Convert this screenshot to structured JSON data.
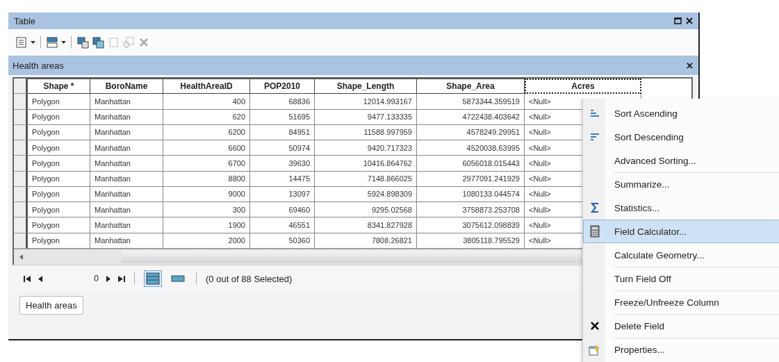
{
  "window": {
    "title": "Table"
  },
  "toolbar": [
    {
      "disabled": false
    },
    {
      "disabled": false
    },
    {
      "disabled": false
    },
    {
      "disabled": false
    },
    {
      "disabled": true
    },
    {
      "disabled": true
    },
    {
      "disabled": true
    }
  ],
  "table_name": "Health areas",
  "table": {
    "columns": [
      {
        "label": "Shape *",
        "selected": false
      },
      {
        "label": "BoroName",
        "selected": false
      },
      {
        "label": "HealthAreaID",
        "selected": false
      },
      {
        "label": "POP2010",
        "selected": false
      },
      {
        "label": "Shape_Length",
        "selected": false
      },
      {
        "label": "Shape_Area",
        "selected": false
      },
      {
        "label": "Acres",
        "selected": true
      }
    ],
    "rows": [
      [
        "Polygon",
        "Manhattan",
        "400",
        "68836",
        "12014.993167",
        "5873344.359519",
        "<Null>"
      ],
      [
        "Polygon",
        "Manhattan",
        "620",
        "51695",
        "9477.133335",
        "4722438.403642",
        "<Null>"
      ],
      [
        "Polygon",
        "Manhattan",
        "6200",
        "84951",
        "11588.997959",
        "4578249.29951",
        "<Null>"
      ],
      [
        "Polygon",
        "Manhattan",
        "6600",
        "50974",
        "9420.717323",
        "4520038.63995",
        "<Null>"
      ],
      [
        "Polygon",
        "Manhattan",
        "6700",
        "39630",
        "10416.864762",
        "6056018.015443",
        "<Null>"
      ],
      [
        "Polygon",
        "Manhattan",
        "8800",
        "14475",
        "7148.866025",
        "2977091.241929",
        "<Null>"
      ],
      [
        "Polygon",
        "Manhattan",
        "9000",
        "13097",
        "5924.898309",
        "1080133.044574",
        "<Null>"
      ],
      [
        "Polygon",
        "Manhattan",
        "300",
        "69460",
        "9295.02568",
        "3758873.253708",
        "<Null>"
      ],
      [
        "Polygon",
        "Manhattan",
        "1900",
        "46551",
        "8341.827928",
        "3075612.098839",
        "<Null>"
      ],
      [
        "Polygon",
        "Manhattan",
        "2000",
        "50360",
        "7808.26821",
        "3805118.795529",
        "<Null>"
      ]
    ]
  },
  "navigator": {
    "record": "0",
    "views": [
      {
        "selected": true
      },
      {
        "selected": false
      }
    ],
    "status": "(0 out of 88 Selected)"
  },
  "tabs": [
    {
      "label": "Health areas",
      "selected": true
    }
  ],
  "context_menu": [
    {
      "label": "Sort Ascending",
      "selected": false,
      "separator_before": false
    },
    {
      "label": "Sort Descending",
      "selected": false,
      "separator_before": false
    },
    {
      "label": "Advanced Sorting...",
      "selected": false,
      "separator_before": false
    },
    {
      "label": "Summarize...",
      "selected": false,
      "separator_before": true
    },
    {
      "label": "Statistics...",
      "selected": false,
      "separator_before": false
    },
    {
      "label": "Field Calculator...",
      "selected": true,
      "separator_before": false
    },
    {
      "label": "Calculate Geometry...",
      "selected": false,
      "separator_before": false
    },
    {
      "label": "Turn Field Off",
      "selected": false,
      "separator_before": true
    },
    {
      "label": "Freeze/Unfreeze Column",
      "selected": false,
      "separator_before": true
    },
    {
      "label": "Delete Field",
      "selected": false,
      "separator_before": true
    },
    {
      "label": "Properties...",
      "selected": false,
      "separator_before": true
    }
  ]
}
